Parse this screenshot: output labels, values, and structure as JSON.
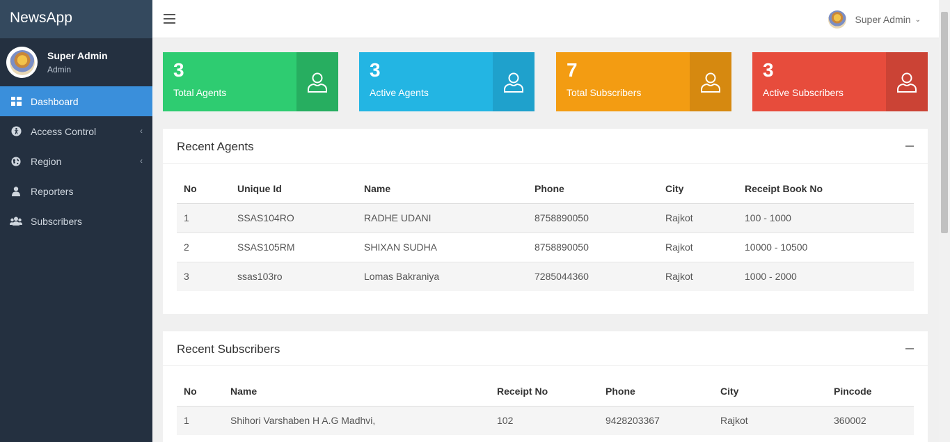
{
  "app": {
    "brand": "NewsApp"
  },
  "profile": {
    "name": "Super Admin",
    "role": "Admin"
  },
  "nav": [
    {
      "label": "Dashboard",
      "icon": "dashboard-icon",
      "active": true
    },
    {
      "label": "Access Control",
      "icon": "access-icon",
      "has_children": true
    },
    {
      "label": "Region",
      "icon": "globe-icon",
      "has_children": true
    },
    {
      "label": "Reporters",
      "icon": "user-icon"
    },
    {
      "label": "Subscribers",
      "icon": "users-icon"
    }
  ],
  "topbar": {
    "user_name": "Super Admin"
  },
  "stats": [
    {
      "value": "3",
      "label": "Total Agents",
      "color": "#2ecc71",
      "dark": "#27ae60"
    },
    {
      "value": "3",
      "label": "Active Agents",
      "color": "#23b5e3",
      "dark": "#1fa1cc"
    },
    {
      "value": "7",
      "label": "Total Subscribers",
      "color": "#f39c12",
      "dark": "#d68910"
    },
    {
      "value": "3",
      "label": "Active Subscribers",
      "color": "#e74c3c",
      "dark": "#cb4335"
    }
  ],
  "recent_agents": {
    "title": "Recent Agents",
    "columns": [
      "No",
      "Unique Id",
      "Name",
      "Phone",
      "City",
      "Receipt Book No"
    ],
    "rows": [
      [
        "1",
        "SSAS104RO",
        "RADHE UDANI",
        "8758890050",
        "Rajkot",
        "100 - 1000"
      ],
      [
        "2",
        "SSAS105RM",
        "SHIXAN SUDHA",
        "8758890050",
        "Rajkot",
        "10000 - 10500"
      ],
      [
        "3",
        "ssas103ro",
        "Lomas Bakraniya",
        "7285044360",
        "Rajkot",
        "1000 - 2000"
      ]
    ]
  },
  "recent_subscribers": {
    "title": "Recent Subscribers",
    "columns": [
      "No",
      "Name",
      "Receipt No",
      "Phone",
      "City",
      "Pincode"
    ],
    "rows": [
      [
        "1",
        "Shihori Varshaben H A.G Madhvi,",
        "102",
        "9428203367",
        "Rajkot",
        "360002"
      ]
    ]
  }
}
